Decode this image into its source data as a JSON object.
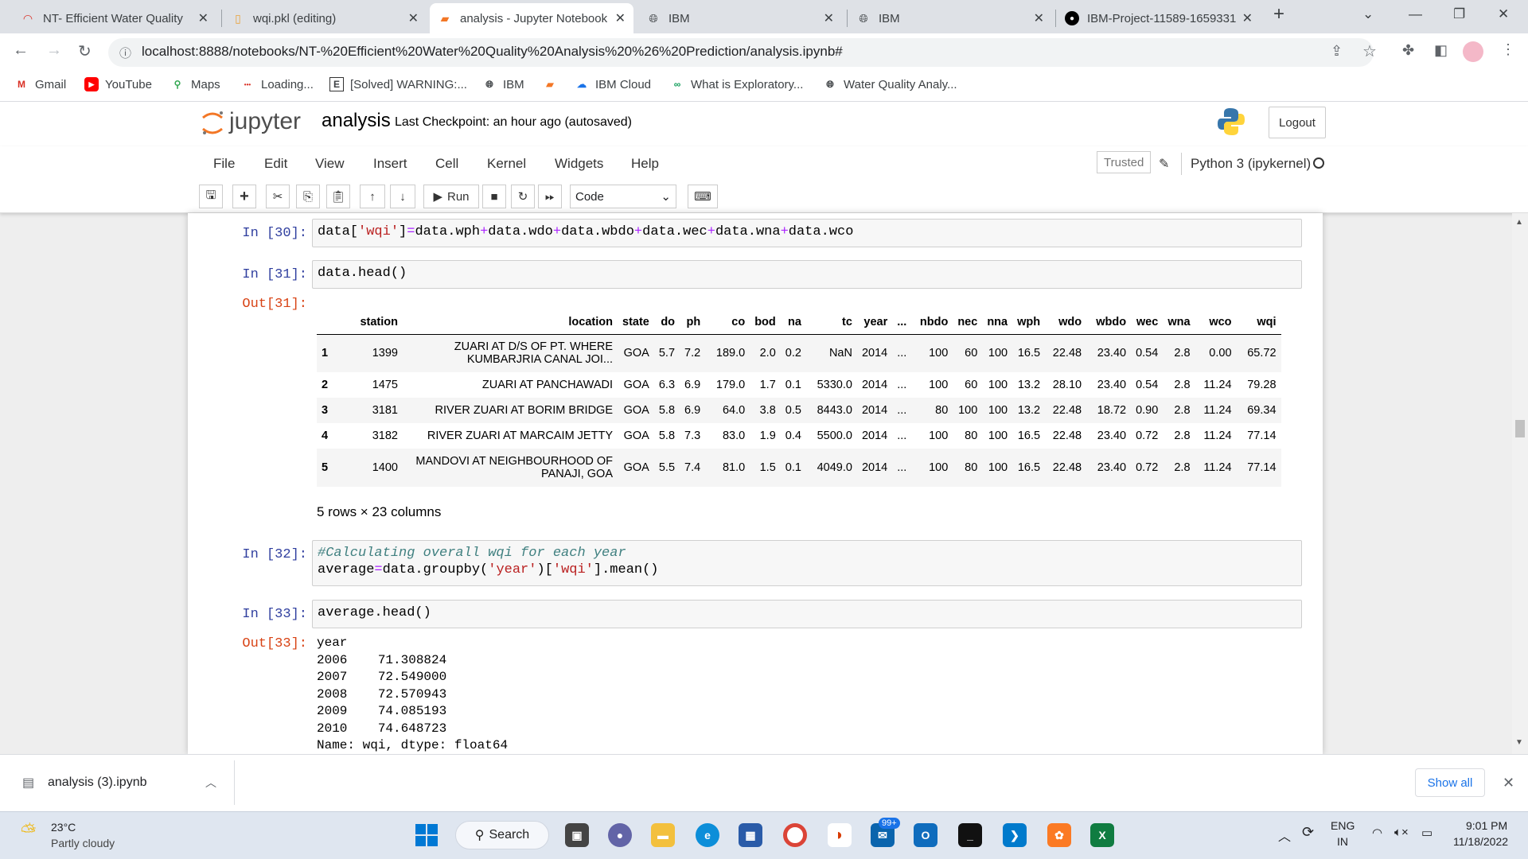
{
  "browser": {
    "tabs": [
      {
        "title": "NT- Efficient Water Quality",
        "icon": "loading-icon"
      },
      {
        "title": "wqi.pkl (editing)",
        "icon": "file-icon"
      },
      {
        "title": "analysis - Jupyter Notebook",
        "icon": "jupyter-icon"
      },
      {
        "title": "IBM",
        "icon": "globe-icon"
      },
      {
        "title": "IBM",
        "icon": "globe-icon"
      },
      {
        "title": "IBM-Project-11589-1659331",
        "icon": "github-icon"
      }
    ],
    "url": "localhost:8888/notebooks/NT-%20Efficient%20Water%20Quality%20Analysis%20%26%20Prediction/analysis.ipynb#",
    "bookmarks": [
      "Gmail",
      "YouTube",
      "Maps",
      "Loading...",
      "[Solved] WARNING:...",
      "IBM",
      "",
      "IBM Cloud",
      "What is Exploratory...",
      "Water Quality Analy..."
    ]
  },
  "jupyter": {
    "logo_text": "jupyter",
    "notebook_name": "analysis",
    "checkpoint": "Last Checkpoint: an hour ago   (autosaved)",
    "logout_label": "Logout",
    "menu": [
      "File",
      "Edit",
      "View",
      "Insert",
      "Cell",
      "Kernel",
      "Widgets",
      "Help"
    ],
    "trusted_label": "Trusted",
    "kernel_label": "Python 3 (ipykernel)",
    "run_label": "Run",
    "cell_type": "Code"
  },
  "cells": {
    "c30_prompt": "In [30]:",
    "c31_prompt": "In [31]:",
    "c31_code": "data.head()",
    "c31_out_prompt": "Out[31]:",
    "c32_prompt": "In [32]:",
    "c33_prompt": "In [33]:",
    "c33_code": "average.head()",
    "c33_out_prompt": "Out[33]:",
    "c33_output": "year\n2006    71.308824\n2007    72.549000\n2008    72.570943\n2009    74.085193\n2010    74.648723\nName: wqi, dtype: float64"
  },
  "dataframe": {
    "columns": [
      "",
      "station",
      "location",
      "state",
      "do",
      "ph",
      "co",
      "bod",
      "na",
      "tc",
      "year",
      "...",
      "nbdo",
      "nec",
      "nna",
      "wph",
      "wdo",
      "wbdo",
      "wec",
      "wna",
      "wco",
      "wqi"
    ],
    "rows": [
      [
        "1",
        "1399",
        "ZUARI AT D/S OF PT. WHERE KUMBARJRIA CANAL JOI...",
        "GOA",
        "5.7",
        "7.2",
        "189.0",
        "2.0",
        "0.2",
        "NaN",
        "2014",
        "...",
        "100",
        "60",
        "100",
        "16.5",
        "22.48",
        "23.40",
        "0.54",
        "2.8",
        "0.00",
        "65.72"
      ],
      [
        "2",
        "1475",
        "ZUARI AT PANCHAWADI",
        "GOA",
        "6.3",
        "6.9",
        "179.0",
        "1.7",
        "0.1",
        "5330.0",
        "2014",
        "...",
        "100",
        "60",
        "100",
        "13.2",
        "28.10",
        "23.40",
        "0.54",
        "2.8",
        "11.24",
        "79.28"
      ],
      [
        "3",
        "3181",
        "RIVER ZUARI AT BORIM BRIDGE",
        "GOA",
        "5.8",
        "6.9",
        "64.0",
        "3.8",
        "0.5",
        "8443.0",
        "2014",
        "...",
        "80",
        "100",
        "100",
        "13.2",
        "22.48",
        "18.72",
        "0.90",
        "2.8",
        "11.24",
        "69.34"
      ],
      [
        "4",
        "3182",
        "RIVER ZUARI AT MARCAIM JETTY",
        "GOA",
        "5.8",
        "7.3",
        "83.0",
        "1.9",
        "0.4",
        "5500.0",
        "2014",
        "...",
        "100",
        "80",
        "100",
        "16.5",
        "22.48",
        "23.40",
        "0.72",
        "2.8",
        "11.24",
        "77.14"
      ],
      [
        "5",
        "1400",
        "MANDOVI AT NEIGHBOURHOOD OF PANAJI, GOA",
        "GOA",
        "5.5",
        "7.4",
        "81.0",
        "1.5",
        "0.1",
        "4049.0",
        "2014",
        "...",
        "100",
        "80",
        "100",
        "16.5",
        "22.48",
        "23.40",
        "0.72",
        "2.8",
        "11.24",
        "77.14"
      ]
    ],
    "shape_text": "5 rows × 23 columns"
  },
  "download": {
    "file": "analysis (3).ipynb",
    "show_all": "Show all"
  },
  "taskbar": {
    "weather_temp": "23°C",
    "weather_desc": "Partly cloudy",
    "search_label": "Search",
    "badge": "99+",
    "lang1": "ENG",
    "lang2": "IN",
    "time": "9:01 PM",
    "date": "11/18/2022"
  },
  "colors": {
    "jupyter_orange": "#f37726",
    "input_prompt": "#303f9f",
    "output_prompt": "#d84315",
    "link_blue": "#1a73e8"
  }
}
